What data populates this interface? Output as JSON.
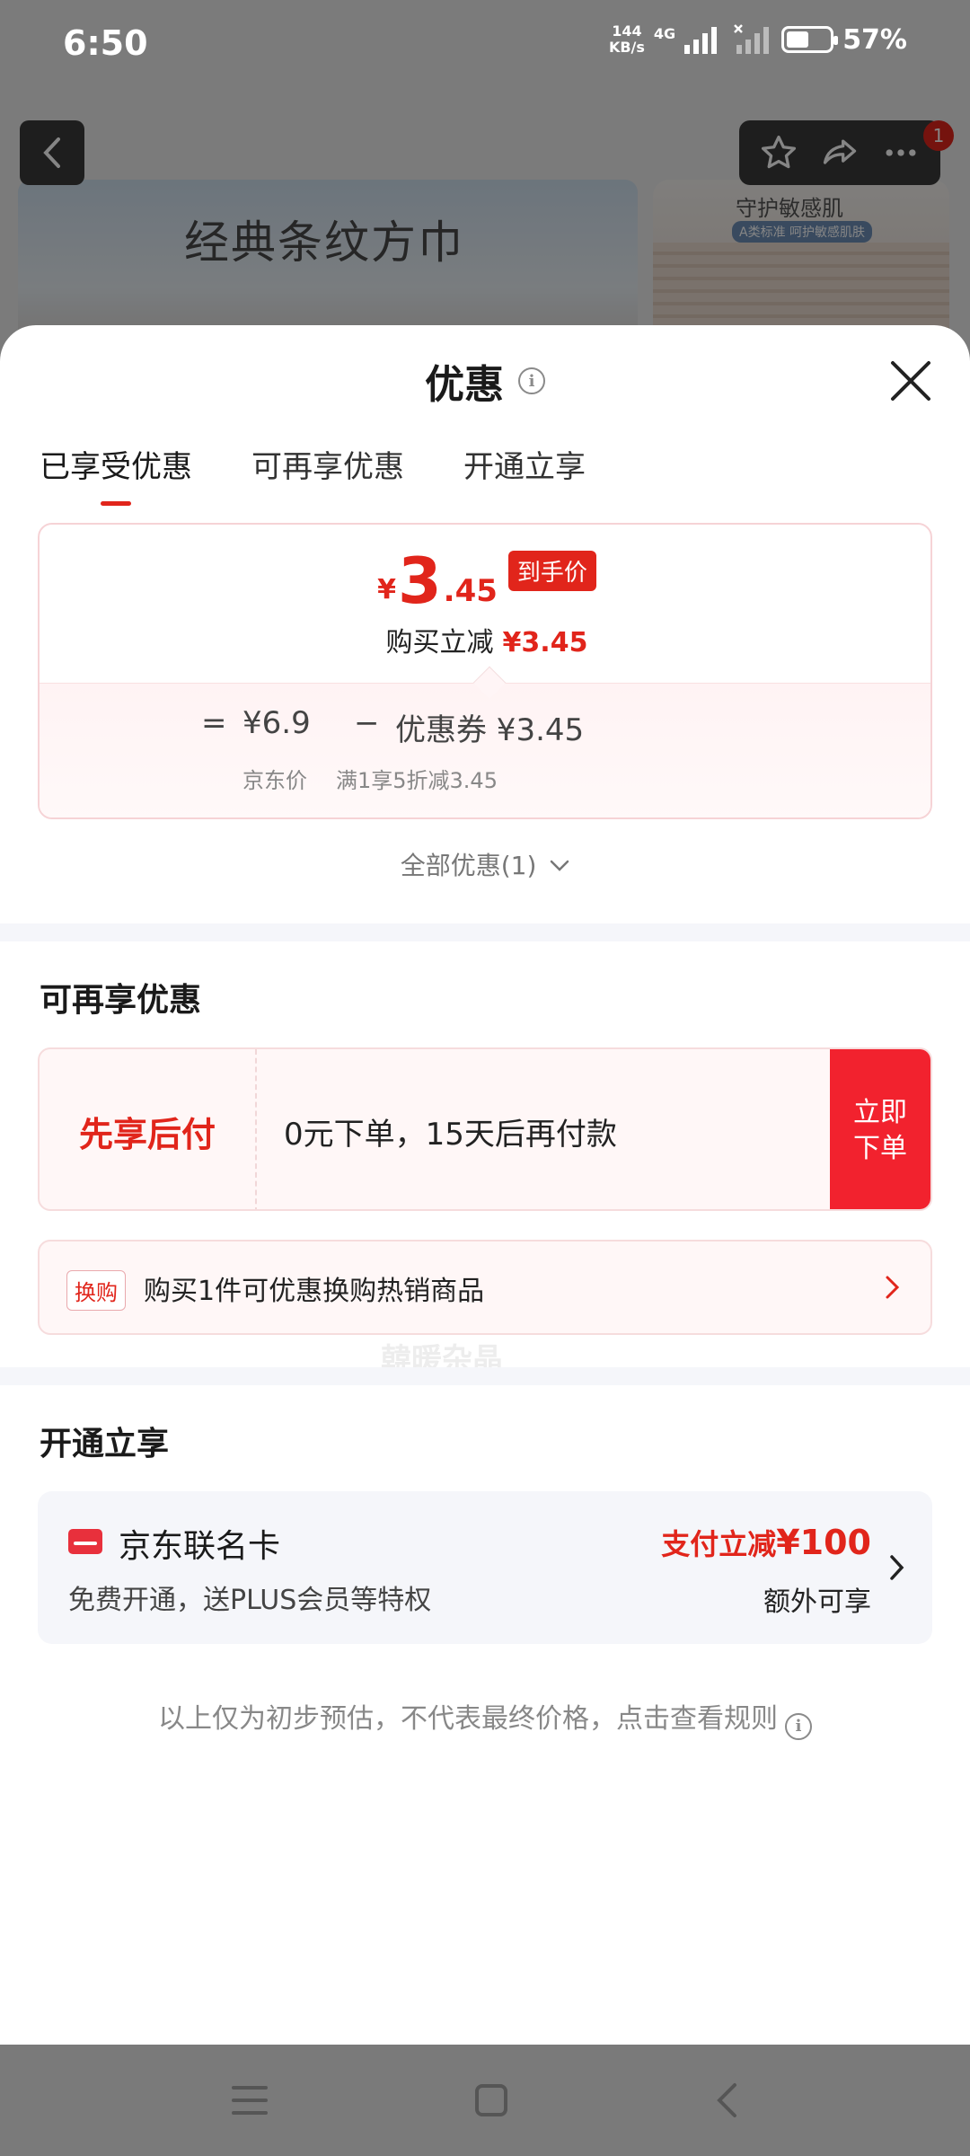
{
  "status_bar": {
    "time": "6:50",
    "speed_value": "144",
    "speed_unit": "KB/s",
    "network": "4G",
    "battery": "57%"
  },
  "background": {
    "banner_title": "经典条纹方巾",
    "thumb_title": "守护敏感肌",
    "thumb_subtitle": "A类标准 呵护敏感肌肤",
    "cart_badge": "1"
  },
  "sheet": {
    "title": "优惠",
    "tabs": [
      "已享受优惠",
      "可再享优惠",
      "开通立享"
    ],
    "price": {
      "symbol": "¥",
      "integer": "3",
      "decimal": ".45",
      "tag": "到手价",
      "sub_label": "购买立减",
      "sub_value": "¥3.45",
      "equals": "=",
      "jd_price": "¥6.9",
      "minus": "−",
      "coupon": "优惠券 ¥3.45",
      "jd_price_label": "京东价",
      "coupon_label": "满1享5折减3.45"
    },
    "all_promos": "全部优惠(1)",
    "more_section": {
      "title": "可再享优惠",
      "pay_later": "先享后付",
      "pay_later_desc": "0元下单，15天后再付款",
      "pay_button": "立即下单",
      "exchange_tag": "换购",
      "exchange_text": "购买1件可优惠换购热销商品"
    },
    "open_section": {
      "title": "开通立享",
      "card_name": "京东联名卡",
      "card_desc": "免费开通，送PLUS会员等特权",
      "promo_label": "支付立减",
      "promo_value": "¥100",
      "extra": "额外可享"
    },
    "disclaimer": "以上仅为初步预估，不代表最终价格，点击查看规则",
    "watermark": "韓暖杂晶"
  },
  "colors": {
    "accent": "#e1251b",
    "pay_button": "#f2222e",
    "card_bg": "#f5f6fa"
  }
}
